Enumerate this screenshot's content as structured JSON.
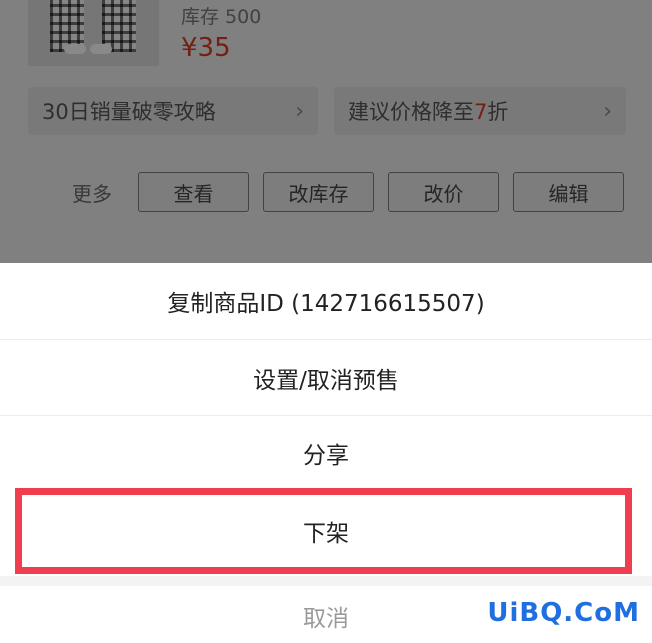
{
  "product": {
    "stock_text": "库存 500",
    "price_text": "¥35"
  },
  "promos": [
    {
      "text": "30日销量破零攻略",
      "chevron": "›"
    },
    {
      "prefix": "建议价格降至",
      "highlight": "7",
      "suffix": "折",
      "chevron": "›"
    }
  ],
  "actions": {
    "more_label": "更多",
    "buttons": [
      "查看",
      "改库存",
      "改价",
      "编辑"
    ]
  },
  "sheet": {
    "items": [
      "复制商品ID (142716615507)",
      "设置/取消预售",
      "分享",
      "下架"
    ],
    "cancel": "取消",
    "highlight_color": "#ef3e4e"
  },
  "watermark": "UiBQ.CoM",
  "colors": {
    "accent_red": "#d23a22",
    "watermark_blue": "#1f6fe0"
  }
}
